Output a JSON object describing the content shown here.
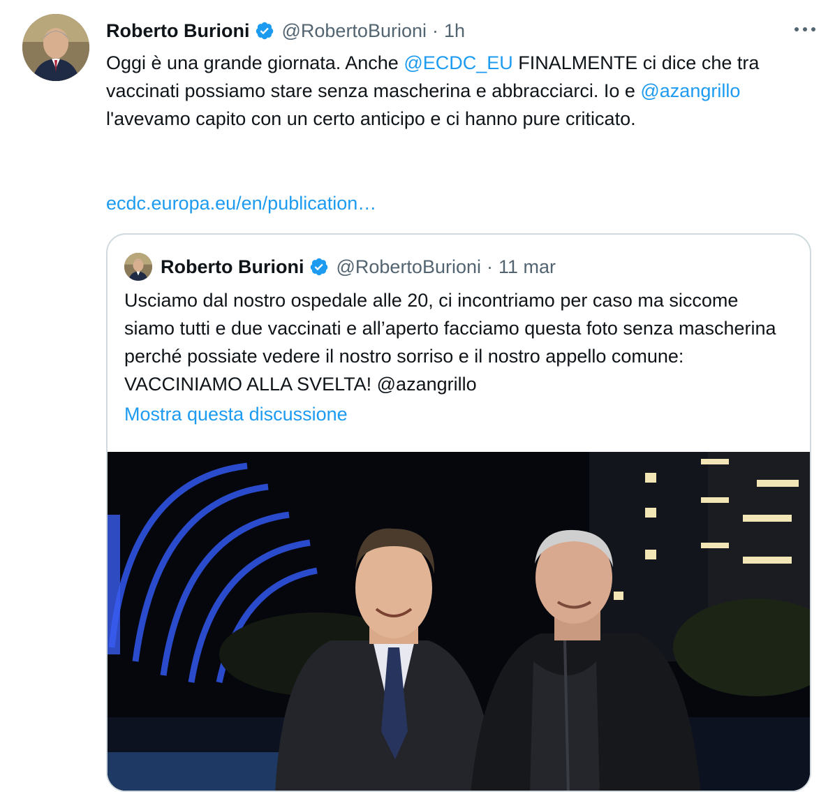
{
  "tweet": {
    "author_name": "Roberto Burioni",
    "handle": "@RobertoBurioni",
    "separator": "·",
    "time": "1h",
    "text_part1": "Oggi è una grande giornata. Anche ",
    "mention1": "@ECDC_EU",
    "text_part2": " FINALMENTE ci dice che tra vaccinati possiamo stare senza mascherina e abbracciarci. Io e ",
    "mention2": "@azangrillo",
    "text_part3": " l'avevamo capito con un certo anticipo e ci hanno pure criticato.",
    "link_text": "ecdc.europa.eu/en/publication…"
  },
  "quoted_tweet": {
    "author_name": "Roberto Burioni",
    "handle": "@RobertoBurioni",
    "separator": "·",
    "date": "11 mar",
    "text_part1": "Usciamo dal nostro ospedale alle 20, ci incontriamo per caso ma siccome siamo tutti e due vaccinati e all’aperto facciamo questa foto senza mascherina perché possiate vedere il nostro sorriso e il nostro appello comune: VACCINIAMO ALLA SVELTA! ",
    "mention": "@azangrillo",
    "show_thread": "Mostra questa discussione"
  },
  "icons": {
    "verified": "verified-badge-icon",
    "more": "more-options-icon"
  },
  "colors": {
    "link": "#1d9bf0",
    "secondary_text": "#536471",
    "border": "#cfd9de"
  }
}
